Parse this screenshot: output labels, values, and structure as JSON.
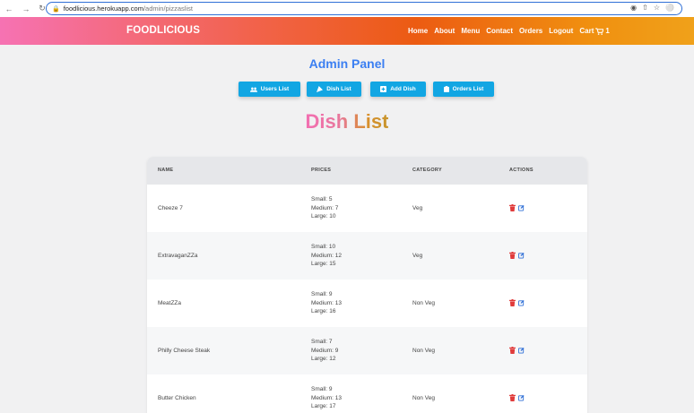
{
  "browser": {
    "url_host": "foodlicious.herokuapp.com",
    "url_path": "/admin/pizzaslist"
  },
  "header": {
    "brand": "FOODLICIOUS",
    "nav": [
      "Home",
      "About",
      "Menu",
      "Contact",
      "Orders",
      "Logout"
    ],
    "cart_label": "Cart",
    "cart_count": "1"
  },
  "admin": {
    "title": "Admin Panel",
    "buttons": [
      "Users List",
      "Dish List",
      "Add Dish",
      "Orders List"
    ]
  },
  "dish_list": {
    "title": "Dish List",
    "columns": [
      "NAME",
      "PRICES",
      "CATEGORY",
      "ACTIONS"
    ],
    "rows": [
      {
        "name": "Cheeze 7",
        "small": "Small: 5",
        "medium": "Medium: 7",
        "large": "Large: 10",
        "category": "Veg"
      },
      {
        "name": "ExtravaganZZa",
        "small": "Small: 10",
        "medium": "Medium: 12",
        "large": "Large: 15",
        "category": "Veg"
      },
      {
        "name": "MeatZZa",
        "small": "Small: 9",
        "medium": "Medium: 13",
        "large": "Large: 16",
        "category": "Non Veg"
      },
      {
        "name": "Philly Cheese Steak",
        "small": "Small: 7",
        "medium": "Medium: 9",
        "large": "Large: 12",
        "category": "Non Veg"
      },
      {
        "name": "Butter Chicken",
        "small": "Small: 9",
        "medium": "Medium: 13",
        "large": "Large: 17",
        "category": "Non Veg"
      }
    ]
  },
  "colors": {
    "accent_blue": "#3b7ff2",
    "button_bg": "#12a6e3",
    "delete_red": "#e03b3b",
    "edit_blue": "#2f6fd6"
  },
  "icons": {
    "users": "users-icon",
    "dish": "pizza-icon",
    "add": "plus-square-icon",
    "orders": "clipboard-icon",
    "delete": "trash-icon",
    "edit": "edit-icon",
    "cart": "cart-icon"
  }
}
